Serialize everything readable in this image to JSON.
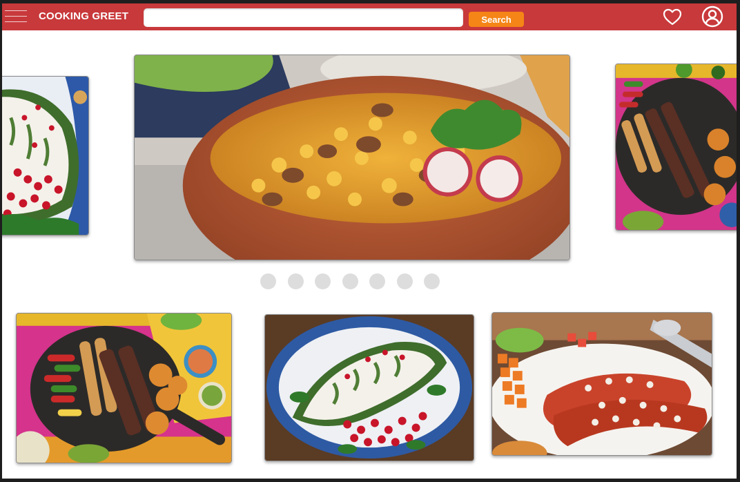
{
  "header": {
    "brand": "COOKING GREET",
    "search_placeholder": "",
    "search_button_label": "Search",
    "menu_icon": "hamburger-menu-icon",
    "favorites_icon": "heart-icon",
    "account_icon": "user-circle-icon",
    "bar_color": "#c8393b",
    "button_color": "#f58516"
  },
  "carousel": {
    "slides": [
      {
        "name": "chiles-en-nogada",
        "position": "previous"
      },
      {
        "name": "pozole",
        "position": "current"
      },
      {
        "name": "fajitas",
        "position": "next"
      }
    ],
    "dot_count": 7
  },
  "cards": [
    {
      "name": "fajitas"
    },
    {
      "name": "chiles-en-nogada"
    },
    {
      "name": "enchiladas"
    }
  ]
}
